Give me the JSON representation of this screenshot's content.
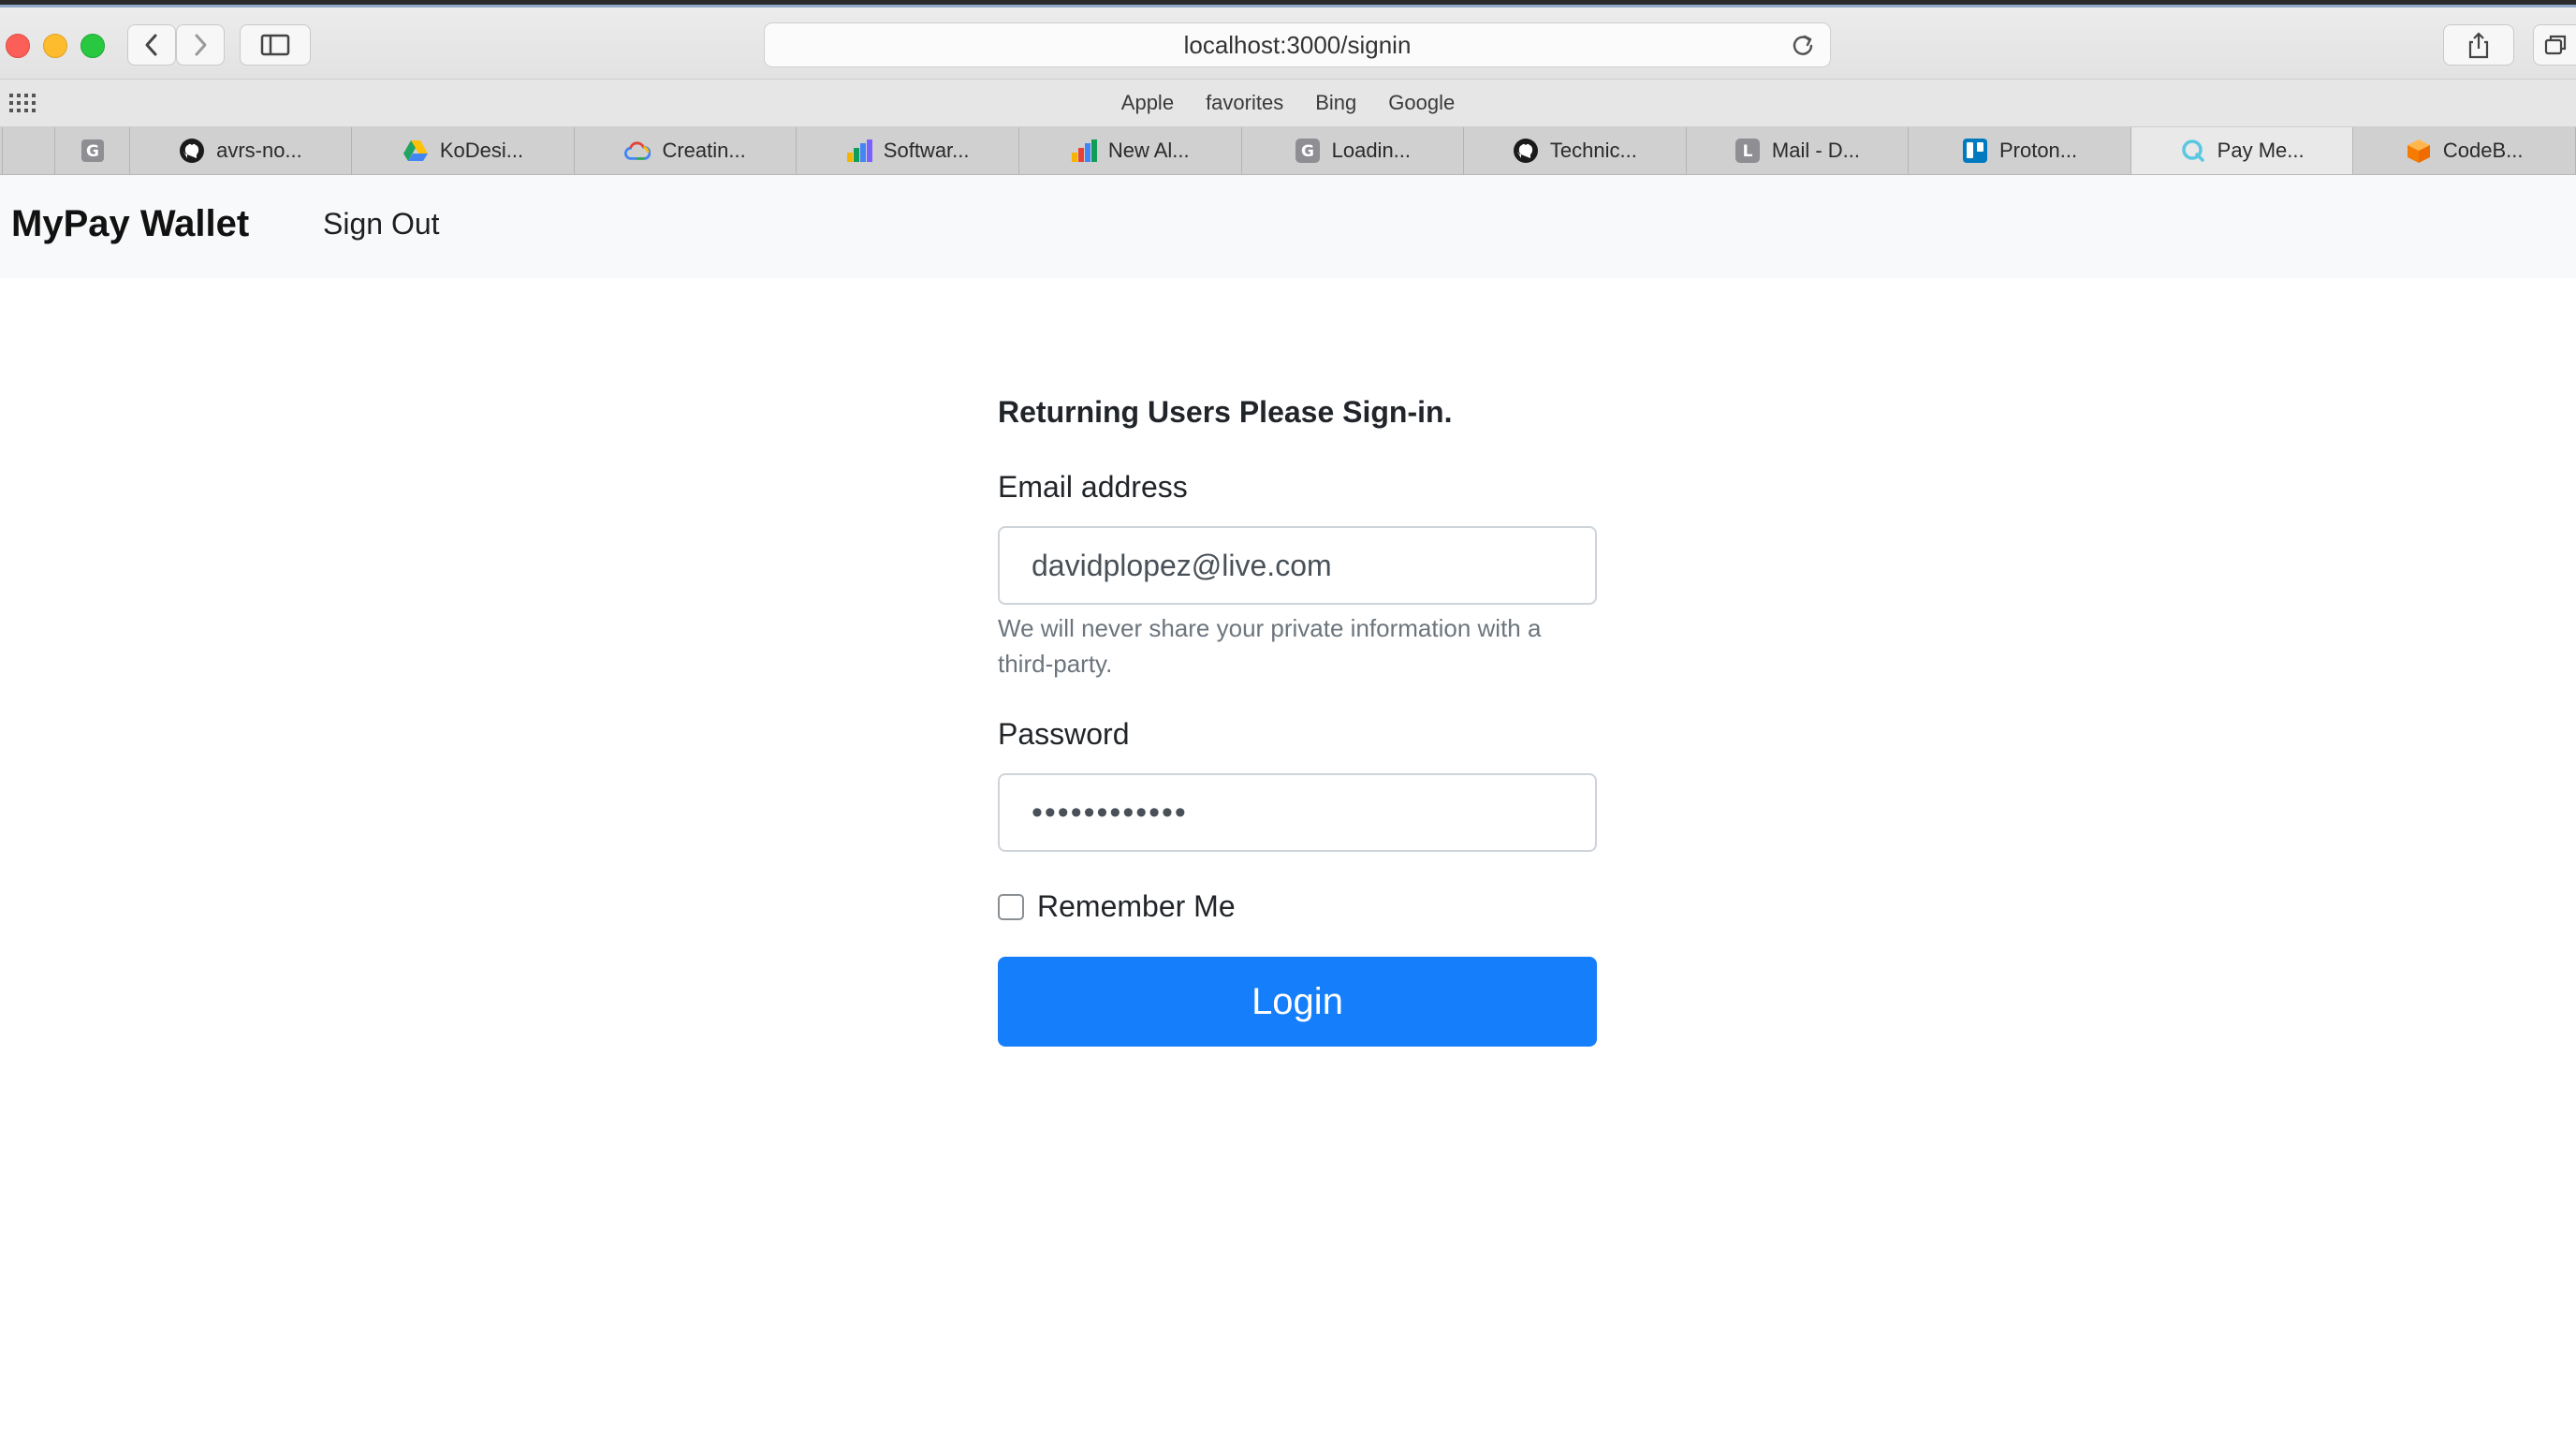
{
  "browser": {
    "url": "localhost:3000/signin",
    "favorites": [
      "Apple",
      "favorites",
      "Bing",
      "Google"
    ],
    "tabs": [
      {
        "label": "",
        "icon": "g-letter-icon"
      },
      {
        "label": "avrs-no...",
        "icon": "github-icon"
      },
      {
        "label": "KoDesi...",
        "icon": "google-drive-icon"
      },
      {
        "label": "Creatin...",
        "icon": "google-cloud-icon"
      },
      {
        "label": "Softwar...",
        "icon": "bar-chart-icon"
      },
      {
        "label": "New Al...",
        "icon": "bar-chart-icon"
      },
      {
        "label": "Loadin...",
        "icon": "g-letter-icon"
      },
      {
        "label": "Technic...",
        "icon": "github-icon"
      },
      {
        "label": "Mail - D...",
        "icon": "l-letter-icon"
      },
      {
        "label": "Proton...",
        "icon": "trello-icon"
      },
      {
        "label": "Pay Me...",
        "icon": "q-circle-icon"
      },
      {
        "label": "CodeB...",
        "icon": "cube-icon"
      }
    ],
    "active_tab_index": 10
  },
  "navbar": {
    "brand": "MyPay Wallet",
    "sign_out": "Sign Out"
  },
  "form": {
    "heading": "Returning Users Please Sign-in.",
    "email_label": "Email address",
    "email_value": "davidplopez@live.com",
    "email_help": "We will never share your private information with a third-party.",
    "password_label": "Password",
    "password_value": "••••••••••••",
    "remember_label": "Remember Me",
    "remember_checked": false,
    "login_label": "Login"
  },
  "colors": {
    "primary": "#157efb",
    "navbar_bg": "#f8f9fa",
    "help_text": "#6c757d"
  }
}
